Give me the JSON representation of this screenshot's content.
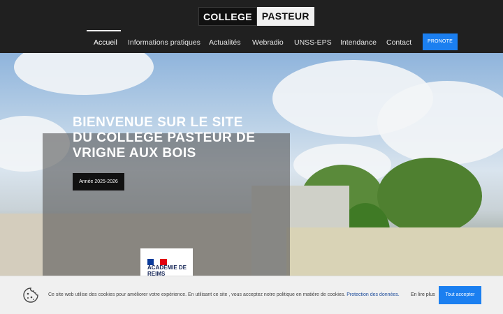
{
  "logo": {
    "left": "COLLEGE",
    "right": "PASTEUR"
  },
  "nav": {
    "items": [
      {
        "label": "Accueil",
        "active": true
      },
      {
        "label": "Informations pratiques"
      },
      {
        "label": "Actualités"
      },
      {
        "label": "Webradio"
      },
      {
        "label": "UNSS-EPS"
      },
      {
        "label": "Intendance"
      },
      {
        "label": "Contact"
      }
    ],
    "pronote_label": "PRONOTE"
  },
  "hero": {
    "title": "BIENVENUE SUR LE SITE DU COLLEGE PASTEUR DE VRIGNE AUX BOIS",
    "year_button": "Année 2025-2026",
    "academie": "ACADÉMIE DE REIMS"
  },
  "cookie": {
    "text": "Ce site web utilise des cookies pour améliorer votre expérience. En utilisant ce site , vous acceptez notre politique en matière de cookies.",
    "link": "Protection des données.",
    "read_more": "En lire plus",
    "accept": "Tout accepter"
  },
  "colors": {
    "accent": "#1b7ff0",
    "header_bg": "#202020"
  }
}
